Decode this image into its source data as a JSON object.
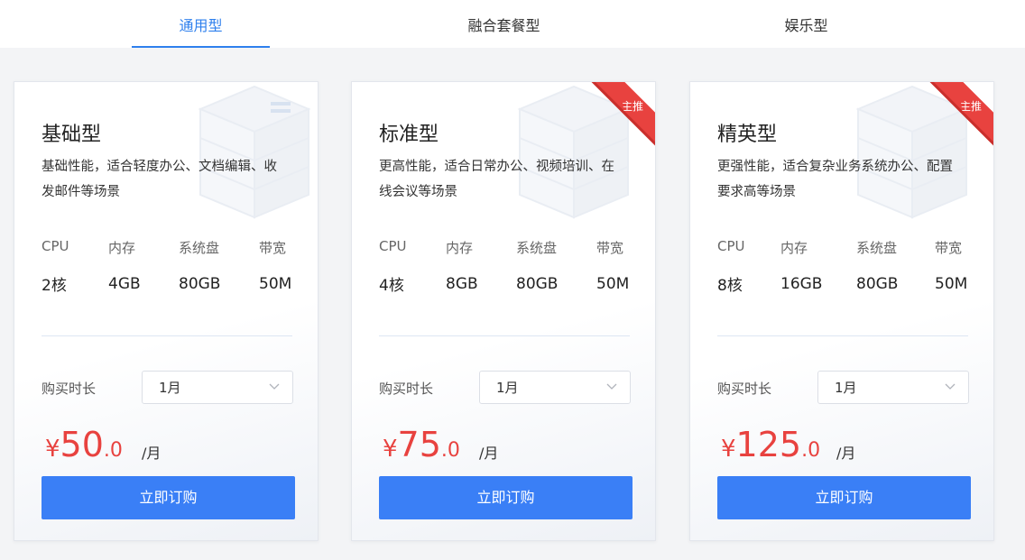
{
  "tabs": [
    {
      "label": "通用型"
    },
    {
      "label": "融合套餐型"
    },
    {
      "label": "娱乐型"
    }
  ],
  "active_tab": 0,
  "colors": {
    "accent": "#2f80ed",
    "button": "#3a7ff6",
    "price": "#e8423f",
    "ribbon": "#e8423f"
  },
  "spec_labels": {
    "cpu": "CPU",
    "memory": "内存",
    "disk": "系统盘",
    "bandwidth": "带宽"
  },
  "duration_label": "购买时长",
  "buy_label": "立即订购",
  "price_currency": "¥",
  "price_unit": "/月",
  "cards": [
    {
      "title": "基础型",
      "description": "基础性能，适合轻度办公、文档编辑、收发邮件等场景",
      "badge": "",
      "specs": {
        "cpu": "2核",
        "memory": "4GB",
        "disk": "80GB",
        "bandwidth": "50M"
      },
      "duration": "1月",
      "price_int": "50",
      "price_dec": ".0"
    },
    {
      "title": "标准型",
      "description": "更高性能，适合日常办公、视频培训、在线会议等场景",
      "badge": "主推",
      "specs": {
        "cpu": "4核",
        "memory": "8GB",
        "disk": "80GB",
        "bandwidth": "50M"
      },
      "duration": "1月",
      "price_int": "75",
      "price_dec": ".0"
    },
    {
      "title": "精英型",
      "description": "更强性能，适合复杂业务系统办公、配置要求高等场景",
      "badge": "主推",
      "specs": {
        "cpu": "8核",
        "memory": "16GB",
        "disk": "80GB",
        "bandwidth": "50M"
      },
      "duration": "1月",
      "price_int": "125",
      "price_dec": ".0"
    }
  ]
}
